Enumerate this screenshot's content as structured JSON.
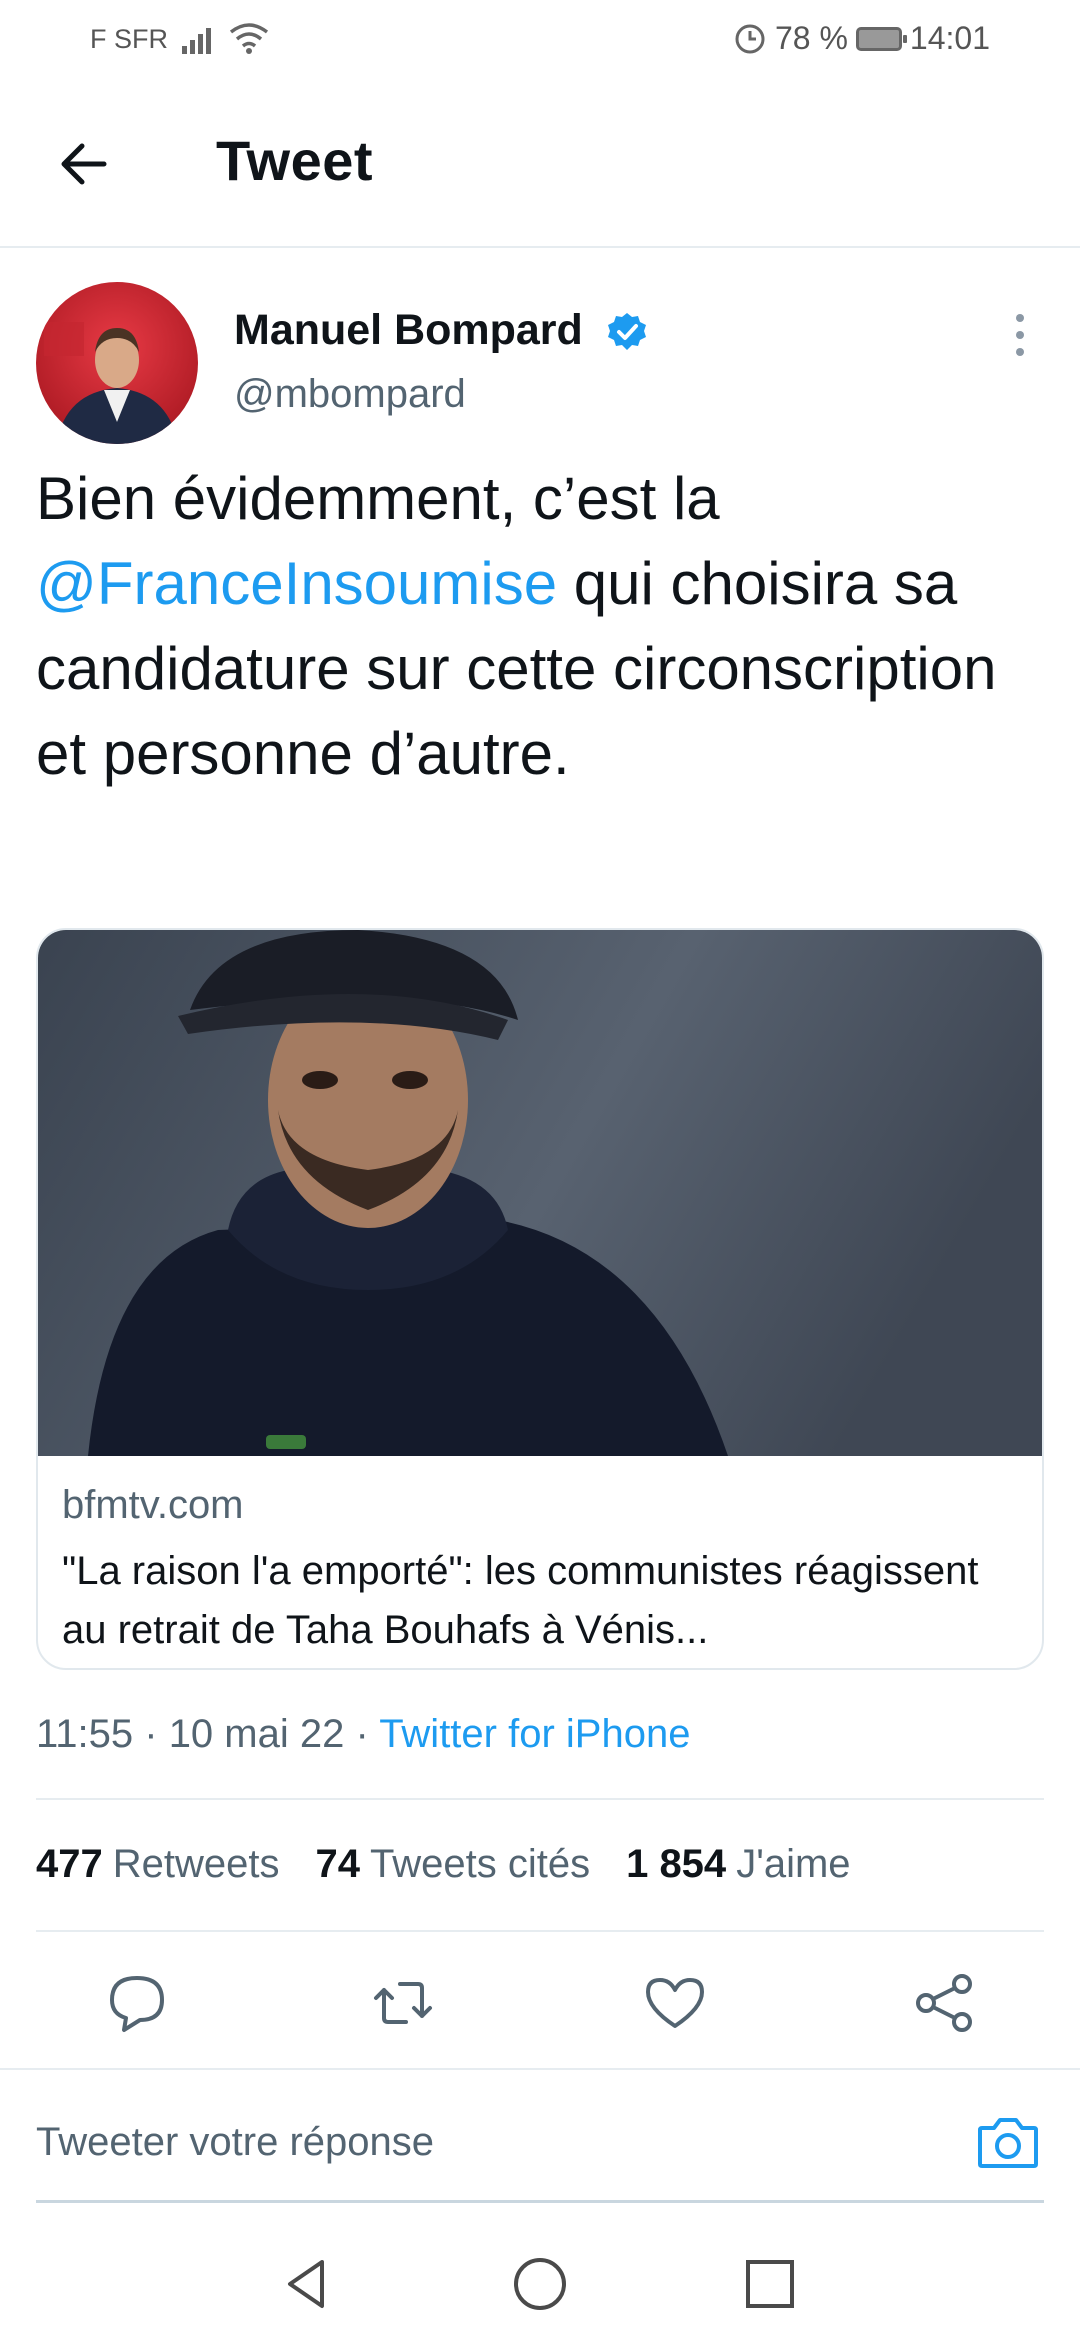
{
  "status_bar": {
    "carrier": "F SFR",
    "battery": "78 %",
    "time": "14:01"
  },
  "header": {
    "title": "Tweet"
  },
  "tweet": {
    "author_name": "Manuel Bompard",
    "handle": "@mbompard",
    "text_before": "Bien évidemment, c’est la ",
    "mention": "@FranceInsoumise",
    "text_after": " qui choisira sa candidature sur cette circonscription et personne d’autre."
  },
  "card": {
    "domain": "bfmtv.com",
    "title": "\"La raison l'a emporté\": les communistes réagissent au retrait de Taha Bouhafs à Vénis..."
  },
  "meta": {
    "time": "11:55",
    "date": "10 mai 22",
    "separator": " · ",
    "source": "Twitter for iPhone"
  },
  "stats": {
    "retweets_count": "477",
    "retweets_label": "Retweets",
    "quotes_count": "74",
    "quotes_label": "Tweets cités",
    "likes_count": "1 854",
    "likes_label": "J'aime"
  },
  "reply": {
    "placeholder": "Tweeter votre réponse"
  },
  "colors": {
    "accent": "#1d9bf0",
    "text": "#0f1419",
    "muted": "#536471"
  },
  "icons": [
    "back-arrow-icon",
    "verified-badge-icon",
    "more-options-icon",
    "reply-icon",
    "retweet-icon",
    "like-icon",
    "share-icon",
    "camera-icon",
    "nav-back-icon",
    "nav-home-icon",
    "nav-recents-icon"
  ]
}
